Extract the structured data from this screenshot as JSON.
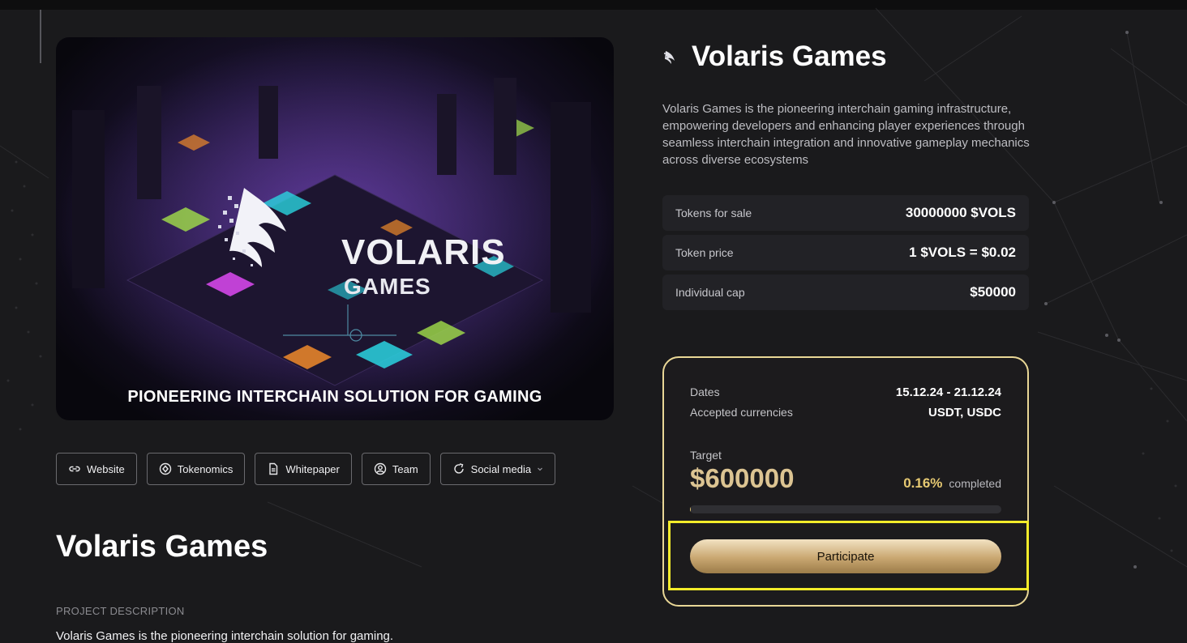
{
  "hero": {
    "logo_text": "VOLARIS",
    "logo_sub": "GAMES",
    "caption": "PIONEERING INTERCHAIN SOLUTION FOR GAMING"
  },
  "links": [
    {
      "label": "Website",
      "icon": "link-icon"
    },
    {
      "label": "Tokenomics",
      "icon": "tokenomics-icon"
    },
    {
      "label": "Whitepaper",
      "icon": "document-icon"
    },
    {
      "label": "Team",
      "icon": "user-icon"
    },
    {
      "label": "Social media",
      "icon": "share-icon"
    }
  ],
  "main": {
    "title": "Volaris Games",
    "section_label": "PROJECT DESCRIPTION",
    "section_text": "Volaris Games is the pioneering interchain solution for gaming."
  },
  "project": {
    "title": "Volaris Games",
    "description": "Volaris Games is the pioneering interchain gaming infrastructure, empowering developers and enhancing player experiences through seamless interchain integration and innovative gameplay mechanics across diverse ecosystems"
  },
  "stats": [
    {
      "label": "Tokens for sale",
      "value": "30000000 $VOLS"
    },
    {
      "label": "Token price",
      "value": "1 $VOLS = $0.02"
    },
    {
      "label": "Individual cap",
      "value": "$50000"
    }
  ],
  "sale": {
    "dates_label": "Dates",
    "dates_value": "15.12.24 - 21.12.24",
    "currencies_label": "Accepted currencies",
    "currencies_value": "USDT, USDC",
    "target_label": "Target",
    "target_value": "$600000",
    "percent": "0.16%",
    "completed_label": "completed",
    "progress_fraction": 0.0016,
    "participate_label": "Participate"
  },
  "colors": {
    "accent_gold": "#e6c972",
    "card_border": "#e9d796",
    "highlight": "#f3ec2a"
  }
}
